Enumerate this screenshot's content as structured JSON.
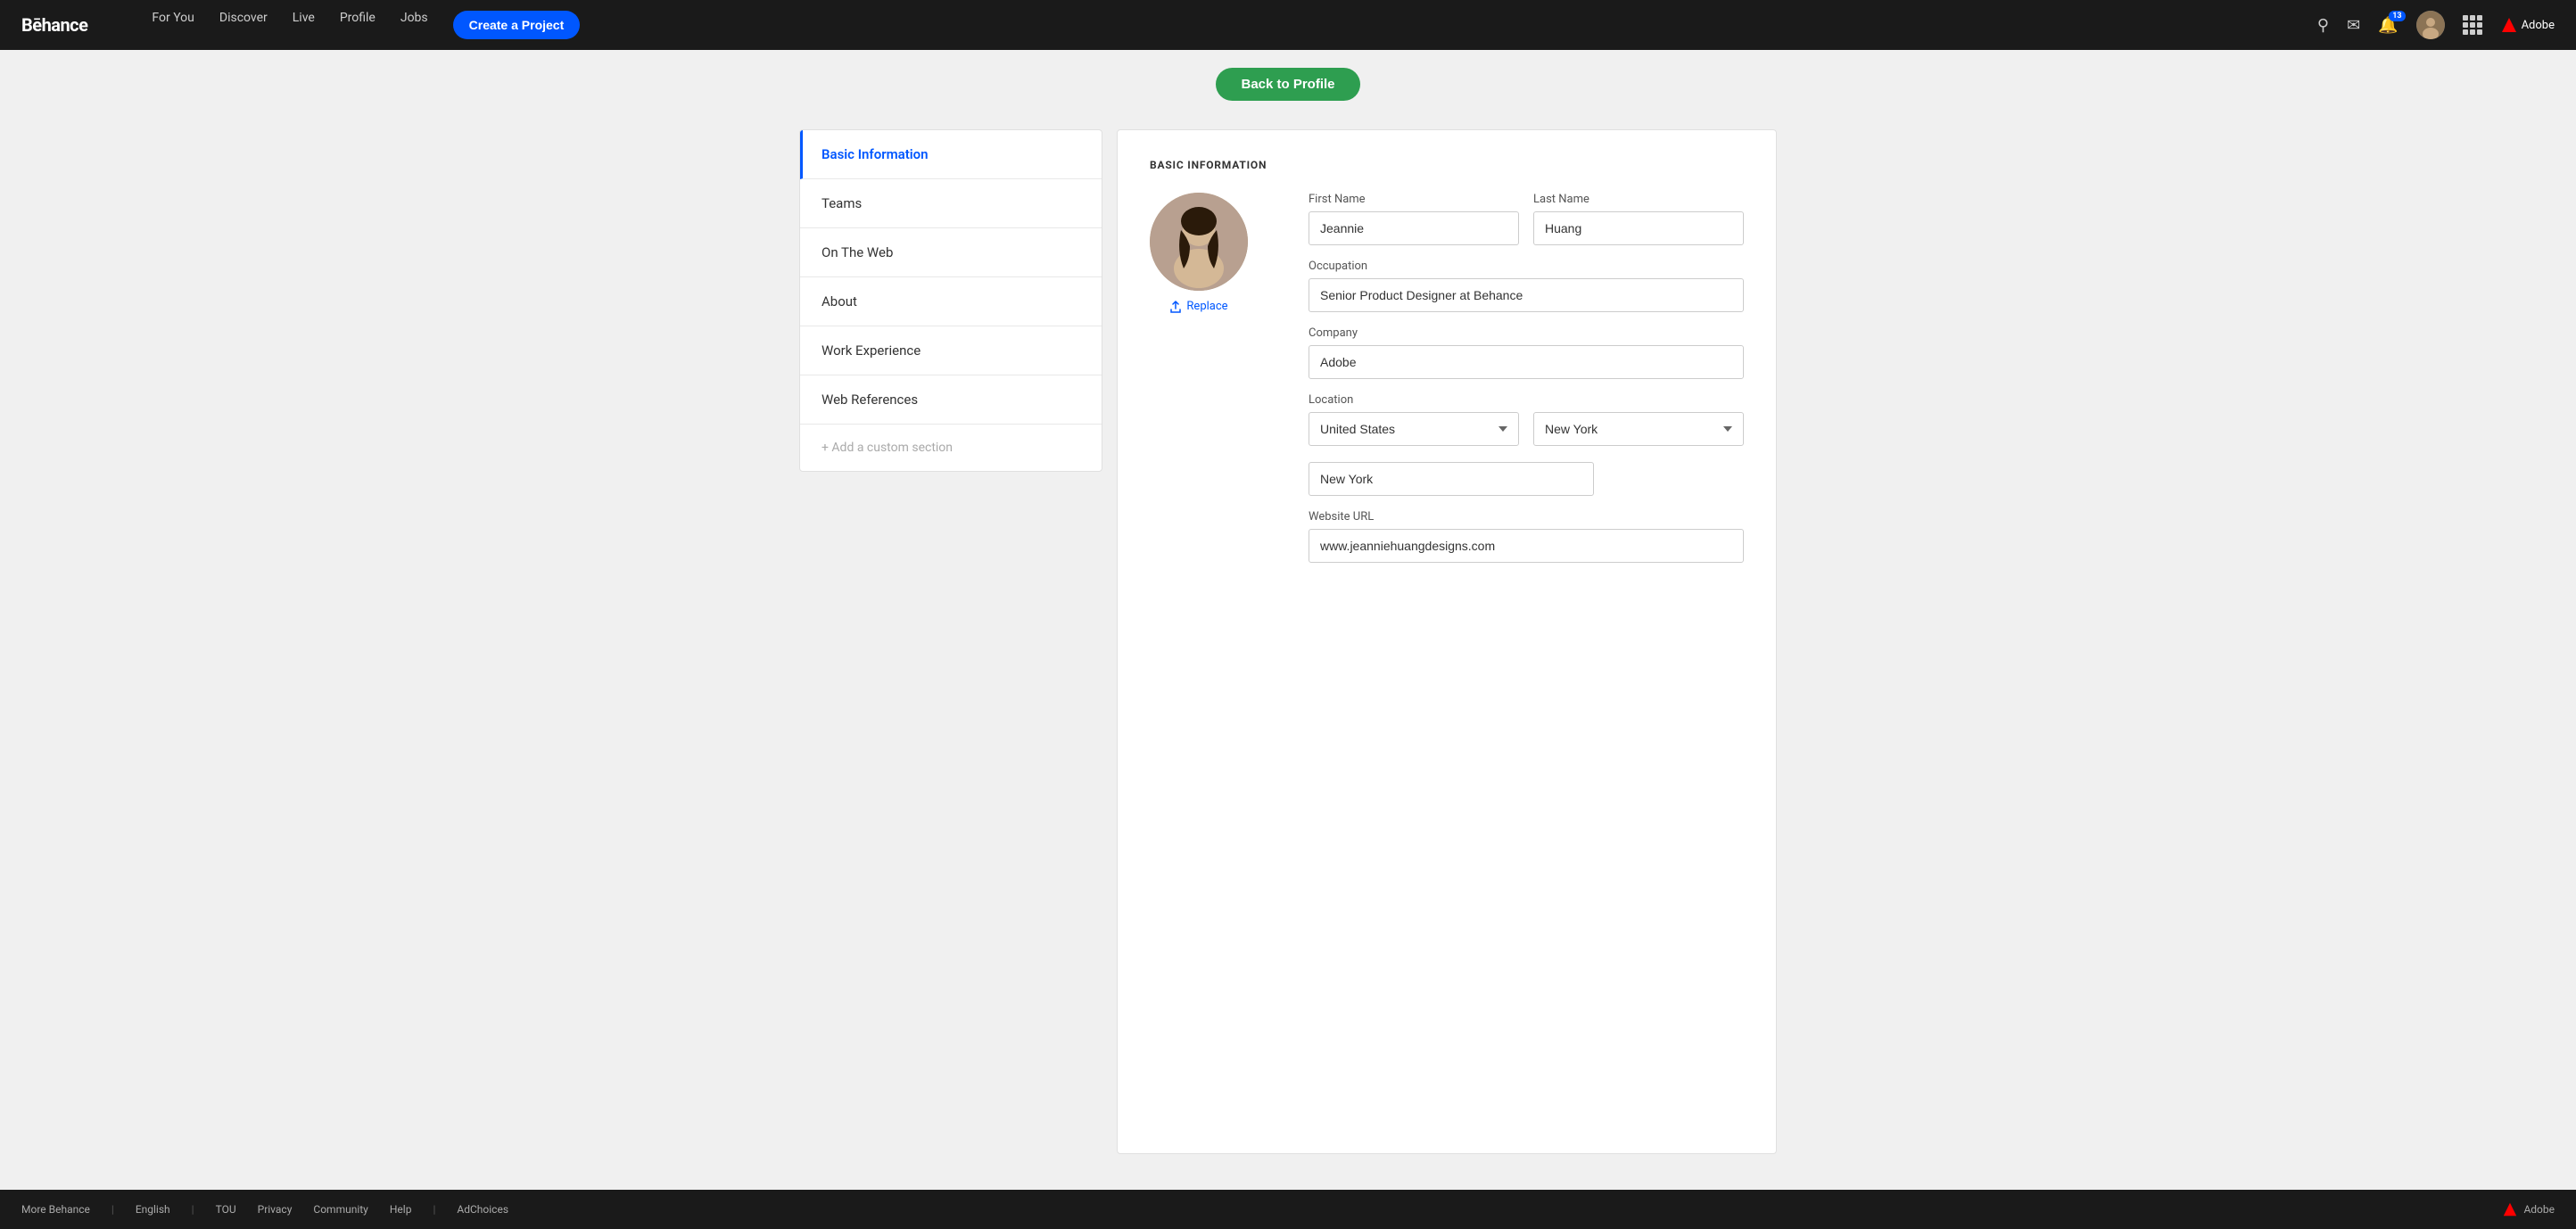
{
  "brand": "Bēhance",
  "navbar": {
    "items": [
      {
        "label": "For You"
      },
      {
        "label": "Discover"
      },
      {
        "label": "Live"
      },
      {
        "label": "Profile"
      },
      {
        "label": "Jobs"
      }
    ],
    "create_label": "Create a Project",
    "notification_count": "13",
    "adobe_label": "Adobe"
  },
  "back_button": "Back to Profile",
  "sidebar": {
    "items": [
      {
        "label": "Basic Information",
        "active": true
      },
      {
        "label": "Teams",
        "active": false
      },
      {
        "label": "On The Web",
        "active": false
      },
      {
        "label": "About",
        "active": false
      },
      {
        "label": "Work Experience",
        "active": false
      },
      {
        "label": "Web References",
        "active": false
      }
    ],
    "add_custom": "+ Add a custom section"
  },
  "form": {
    "section_title": "BASIC INFORMATION",
    "replace_label": "Replace",
    "first_name_label": "First Name",
    "first_name_value": "Jeannie",
    "last_name_label": "Last Name",
    "last_name_value": "Huang",
    "occupation_label": "Occupation",
    "occupation_value": "Senior Product Designer at Behance",
    "company_label": "Company",
    "company_value": "Adobe",
    "location_label": "Location",
    "country_value": "United States",
    "state_value": "New York",
    "city_value": "New York",
    "website_label": "Website URL",
    "website_value": "www.jeanniehuangdesigns.com"
  },
  "footer": {
    "more_behance": "More Behance",
    "language": "English",
    "links": [
      "TOU",
      "Privacy",
      "Community",
      "Help"
    ],
    "ad_choices": "AdChoices",
    "adobe_label": "Adobe"
  }
}
